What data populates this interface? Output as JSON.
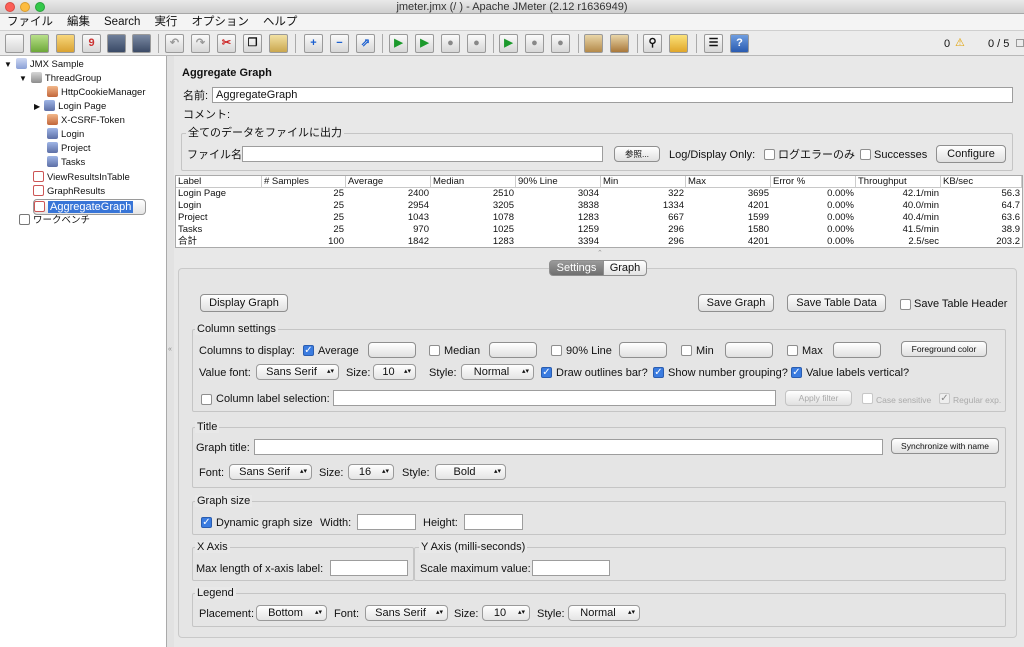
{
  "window": {
    "title": "jmeter.jmx (/                                    ) - Apache JMeter (2.12 r1636949)"
  },
  "menu": [
    "ファイル",
    "編集",
    "Search",
    "実行",
    "オプション",
    "ヘルプ"
  ],
  "status": {
    "errors": "0",
    "threads": "0 / 5"
  },
  "tree": [
    {
      "label": "JMX Sample",
      "level": 0
    },
    {
      "label": "ThreadGroup",
      "level": 1
    },
    {
      "label": "HttpCookieManager",
      "level": 2
    },
    {
      "label": "Login Page",
      "level": 2
    },
    {
      "label": "X-CSRF-Token",
      "level": 2
    },
    {
      "label": "Login",
      "level": 2
    },
    {
      "label": "Project",
      "level": 2
    },
    {
      "label": "Tasks",
      "level": 2
    },
    {
      "label": "ViewResultsInTable",
      "level": 1
    },
    {
      "label": "GraphResults",
      "level": 1
    },
    {
      "label": "AggregateGraph",
      "level": 1,
      "selected": true
    },
    {
      "label": "ワークベンチ",
      "level": 0
    }
  ],
  "panel": {
    "title": "Aggregate Graph",
    "name_label": "名前:",
    "name_value": "AggregateGraph",
    "comment_label": "コメント:",
    "file_group": "全てのデータをファイルに出力",
    "file_label": "ファイル名",
    "browse": "参照...",
    "log_display": "Log/Display Only:",
    "errors_only": "ログエラーのみ",
    "successes": "Successes",
    "configure": "Configure"
  },
  "table": {
    "headers": [
      "Label",
      "# Samples",
      "Average",
      "Median",
      "90% Line",
      "Min",
      "Max",
      "Error %",
      "Throughput",
      "KB/sec"
    ],
    "rows": [
      [
        "Login Page",
        "25",
        "2400",
        "2510",
        "3034",
        "322",
        "3695",
        "0.00%",
        "42.1/min",
        "56.3"
      ],
      [
        "Login",
        "25",
        "2954",
        "3205",
        "3838",
        "1334",
        "4201",
        "0.00%",
        "40.0/min",
        "64.7"
      ],
      [
        "Project",
        "25",
        "1043",
        "1078",
        "1283",
        "667",
        "1599",
        "0.00%",
        "40.4/min",
        "63.6"
      ],
      [
        "Tasks",
        "25",
        "970",
        "1025",
        "1259",
        "296",
        "1580",
        "0.00%",
        "41.5/min",
        "38.9"
      ],
      [
        "合計",
        "100",
        "1842",
        "1283",
        "3394",
        "296",
        "4201",
        "0.00%",
        "2.5/sec",
        "203.2"
      ]
    ]
  },
  "tabs": [
    "Settings",
    "Graph"
  ],
  "settings": {
    "display_graph": "Display Graph",
    "save_graph": "Save Graph",
    "save_table_data": "Save Table Data",
    "save_table_header": "Save Table Header",
    "column_settings": "Column settings",
    "columns_to_display": "Columns to display:",
    "average": "Average",
    "median": "Median",
    "line90": "90% Line",
    "min": "Min",
    "max": "Max",
    "foreground_color": "Foreground color",
    "value_font": "Value font:",
    "value_font_value": "Sans Serif",
    "size": "Size:",
    "value_size": "10",
    "style": "Style:",
    "value_style": "Normal",
    "draw_outlines": "Draw outlines bar?",
    "number_grouping": "Show number grouping?",
    "labels_vertical": "Value labels vertical?",
    "column_label_selection": "Column label selection:",
    "apply_filter": "Apply filter",
    "case_sensitive": "Case sensitive",
    "regular_exp": "Regular exp.",
    "title_group": "Title",
    "graph_title": "Graph title:",
    "sync_name": "Synchronize with name",
    "font": "Font:",
    "title_font": "Sans Serif",
    "title_size": "16",
    "title_style": "Bold",
    "graph_size": "Graph size",
    "dynamic_size": "Dynamic graph size",
    "width": "Width:",
    "height": "Height:",
    "x_axis": "X Axis",
    "max_xlabel": "Max length of x-axis label:",
    "y_axis": "Y Axis (milli-seconds)",
    "scale_max": "Scale maximum value:",
    "legend": "Legend",
    "placement": "Placement:",
    "placement_value": "Bottom",
    "legend_font": "Sans Serif",
    "legend_size": "10",
    "legend_style": "Normal"
  }
}
